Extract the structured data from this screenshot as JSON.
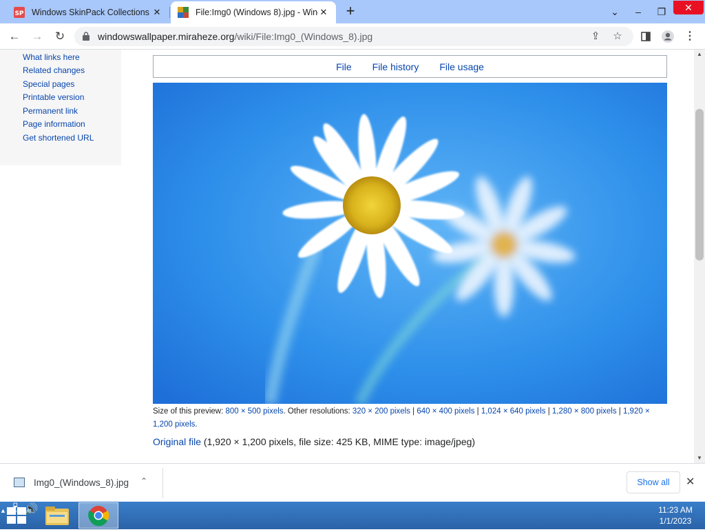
{
  "tabs": [
    {
      "title": "Windows SkinPack Collections - S",
      "favicon": "skinpack-icon"
    },
    {
      "title": "File:Img0 (Windows 8).jpg - Wind",
      "favicon": "wiki-icon"
    }
  ],
  "address": {
    "domain": "windowswallpaper.miraheze.org",
    "path": "/wiki/File:Img0_(Windows_8).jpg"
  },
  "sidebar": {
    "items": [
      "What links here",
      "Related changes",
      "Special pages",
      "Printable version",
      "Permanent link",
      "Page information",
      "Get shortened URL"
    ]
  },
  "file_tabs": [
    "File",
    "File history",
    "File usage"
  ],
  "caption": {
    "prefix": "Size of this preview: ",
    "preview_size": "800 × 500 pixels",
    "middle": ". Other resolutions: ",
    "resolutions": [
      "320 × 200 pixels",
      "640 × 400 pixels",
      "1,024 × 640 pixels",
      "1,280 × 800 pixels",
      "1,920 × 1,200 pixels"
    ],
    "separator": " | ",
    "suffix": "."
  },
  "original": {
    "link": "Original file",
    "details": " (1,920 × 1,200 pixels, file size: 425 KB, MIME type: image/jpeg)"
  },
  "download": {
    "filename": "Img0_(Windows_8).jpg",
    "show_all": "Show all"
  },
  "clock": {
    "time": "11:23 AM",
    "date": "1/1/2023"
  },
  "colors": {
    "tabstrip": "#a8c7fa",
    "link": "#0645ad",
    "taskbar": "#2a63a8",
    "sky": "#2e8fea"
  }
}
